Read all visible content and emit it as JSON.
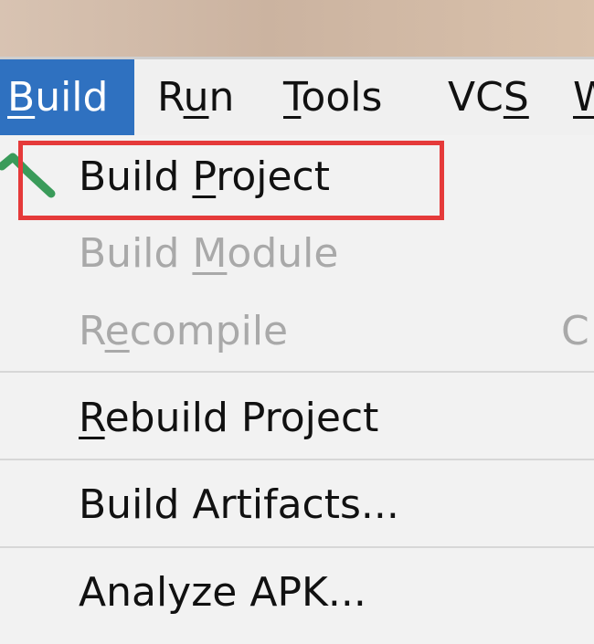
{
  "menubar": {
    "build": {
      "pre": "",
      "mnemonic": "B",
      "post": "uild"
    },
    "run": {
      "pre": "R",
      "mnemonic": "u",
      "post": "n"
    },
    "tools": {
      "pre": "",
      "mnemonic": "T",
      "post": "ools"
    },
    "vcs": {
      "pre": "VC",
      "mnemonic": "S",
      "post": ""
    },
    "window": {
      "pre": "",
      "mnemonic": "W",
      "post": ""
    }
  },
  "build_menu": {
    "build_project": {
      "pre": "Build ",
      "mnemonic": "P",
      "post": "roject"
    },
    "build_module": {
      "pre": "Build ",
      "mnemonic": "M",
      "post": "odule"
    },
    "recompile": {
      "pre": "R",
      "mnemonic": "e",
      "post": "compile",
      "shortcut": "C"
    },
    "rebuild_project": {
      "pre": "",
      "mnemonic": "R",
      "post": "ebuild Project"
    },
    "build_artifacts": {
      "label": "Build Artifacts..."
    },
    "analyze_apk": {
      "label": "Analyze APK..."
    }
  },
  "colors": {
    "menubar_active_bg": "#2f71c0",
    "highlight_box": "#e53a3a",
    "build_icon": "#3a9b5a",
    "disabled_text": "#a9a9a9"
  },
  "icons": {
    "build_project": "hammer-icon"
  }
}
